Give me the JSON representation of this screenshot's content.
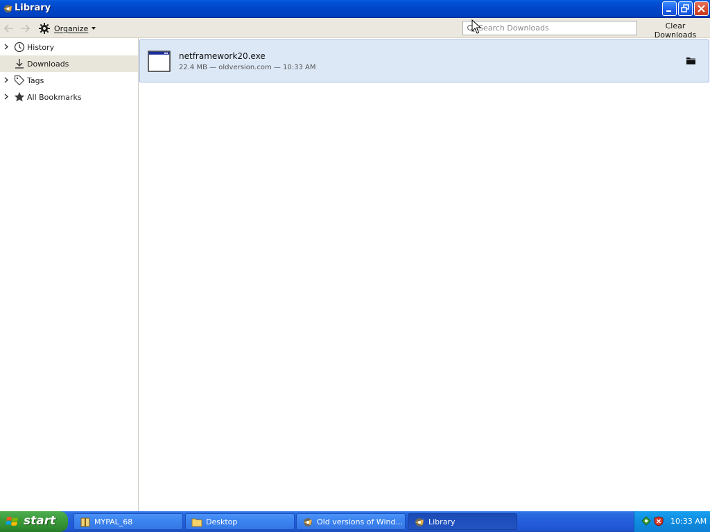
{
  "window": {
    "title": "Library"
  },
  "toolbar": {
    "organize_label": "Organize",
    "search_placeholder": "Search Downloads",
    "clear_label": "Clear Downloads"
  },
  "sidebar": {
    "items": [
      {
        "label": "History",
        "icon": "clock-icon",
        "expandable": true,
        "selected": false
      },
      {
        "label": "Downloads",
        "icon": "download-arrow-icon",
        "expandable": false,
        "selected": true
      },
      {
        "label": "Tags",
        "icon": "tag-icon",
        "expandable": true,
        "selected": false
      },
      {
        "label": "All Bookmarks",
        "icon": "star-icon",
        "expandable": true,
        "selected": false
      }
    ]
  },
  "downloads": [
    {
      "filename": "netframework20.exe",
      "meta": "22.4 MB — oldversion.com — 10:33 AM"
    }
  ],
  "taskbar": {
    "start_label": "start",
    "tasks": [
      {
        "label": "MYPAL_68",
        "icon": "archive-icon",
        "active": false
      },
      {
        "label": "Desktop",
        "icon": "folder-icon",
        "active": false
      },
      {
        "label": "Old versions of Wind...",
        "icon": "browser-icon",
        "active": false
      },
      {
        "label": "Library",
        "icon": "browser-icon",
        "active": true
      }
    ],
    "clock": "10:33 AM"
  },
  "colors": {
    "titlebar": "#0046c8",
    "selection": "#dde8f6",
    "taskbar": "#245ddb",
    "start": "#3c9c3a"
  }
}
